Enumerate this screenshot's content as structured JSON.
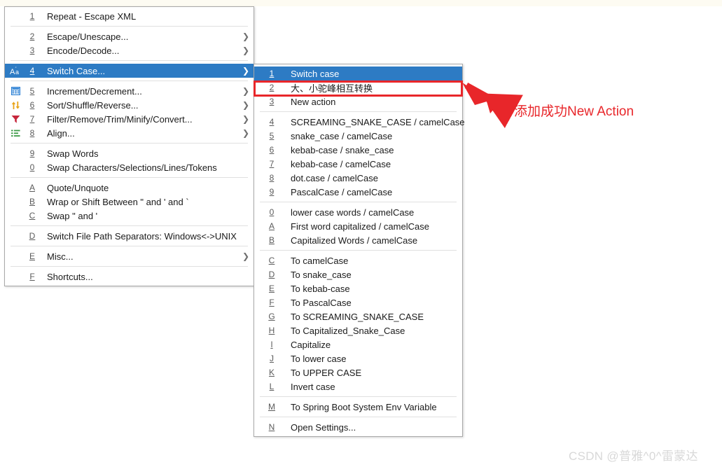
{
  "app": {
    "context": "String Manipulation plugin context menu",
    "accent_blue": "#2d7bc4",
    "annotation_red": "#e8262a",
    "watermark_color": "#d8d8d8"
  },
  "annotation": {
    "text": "添加成功New Action",
    "arrow": "red-arrow-pointing-left",
    "highlight_target": "大、小驼峰相互转换"
  },
  "watermark": {
    "text": "CSDN @普雅^0^雷蒙达"
  },
  "left_menu": {
    "name": "String Manipulation main menu",
    "groups": [
      {
        "items": [
          {
            "mnemonic": "1",
            "label": "Repeat - Escape XML",
            "icon": "",
            "submenu": false,
            "selected": false
          }
        ]
      },
      {
        "items": [
          {
            "mnemonic": "2",
            "label": "Escape/Unescape...",
            "icon": "",
            "submenu": true,
            "selected": false
          },
          {
            "mnemonic": "3",
            "label": "Encode/Decode...",
            "icon": "",
            "submenu": true,
            "selected": false
          }
        ]
      },
      {
        "items": [
          {
            "mnemonic": "4",
            "label": "Switch Case...",
            "icon": "switch-case-aa-icon",
            "submenu": true,
            "selected": true
          }
        ]
      },
      {
        "items": [
          {
            "mnemonic": "5",
            "label": "Increment/Decrement...",
            "icon": "table-grid-icon",
            "submenu": true,
            "selected": false
          },
          {
            "mnemonic": "6",
            "label": "Sort/Shuffle/Reverse...",
            "icon": "sort-arrows-icon",
            "submenu": true,
            "selected": false
          },
          {
            "mnemonic": "7",
            "label": "Filter/Remove/Trim/Minify/Convert...",
            "icon": "filter-funnel-icon",
            "submenu": true,
            "selected": false
          },
          {
            "mnemonic": "8",
            "label": "Align...",
            "icon": "align-lines-icon",
            "submenu": true,
            "selected": false
          }
        ]
      },
      {
        "items": [
          {
            "mnemonic": "9",
            "label": "Swap Words",
            "icon": "",
            "submenu": false,
            "selected": false
          },
          {
            "mnemonic": "0",
            "label": "Swap Characters/Selections/Lines/Tokens",
            "icon": "",
            "submenu": false,
            "selected": false
          }
        ]
      },
      {
        "items": [
          {
            "mnemonic": "A",
            "label": "Quote/Unquote",
            "icon": "",
            "submenu": false,
            "selected": false
          },
          {
            "mnemonic": "B",
            "label": "Wrap or Shift Between \" and ' and `",
            "icon": "",
            "submenu": false,
            "selected": false
          },
          {
            "mnemonic": "C",
            "label": "Swap \" and '",
            "icon": "",
            "submenu": false,
            "selected": false
          }
        ]
      },
      {
        "items": [
          {
            "mnemonic": "D",
            "label": "Switch File Path Separators: Windows<->UNIX",
            "icon": "",
            "submenu": false,
            "selected": false
          }
        ]
      },
      {
        "items": [
          {
            "mnemonic": "E",
            "label": "Misc...",
            "icon": "",
            "submenu": true,
            "selected": false
          }
        ]
      },
      {
        "items": [
          {
            "mnemonic": "F",
            "label": "Shortcuts...",
            "icon": "",
            "submenu": false,
            "selected": false
          }
        ]
      }
    ]
  },
  "sub_menu": {
    "name": "Switch Case submenu",
    "groups": [
      {
        "items": [
          {
            "mnemonic": "1",
            "label": "Switch case",
            "selected": true,
            "boxed": false
          },
          {
            "mnemonic": "2",
            "label": "大、小驼峰相互转换",
            "selected": false,
            "boxed": true
          },
          {
            "mnemonic": "3",
            "label": "New action",
            "selected": false,
            "boxed": false
          }
        ]
      },
      {
        "items": [
          {
            "mnemonic": "4",
            "label": "SCREAMING_SNAKE_CASE / camelCase",
            "selected": false,
            "boxed": false
          },
          {
            "mnemonic": "5",
            "label": "snake_case / camelCase",
            "selected": false,
            "boxed": false
          },
          {
            "mnemonic": "6",
            "label": "kebab-case / snake_case",
            "selected": false,
            "boxed": false
          },
          {
            "mnemonic": "7",
            "label": "kebab-case / camelCase",
            "selected": false,
            "boxed": false
          },
          {
            "mnemonic": "8",
            "label": "dot.case / camelCase",
            "selected": false,
            "boxed": false
          },
          {
            "mnemonic": "9",
            "label": "PascalCase / camelCase",
            "selected": false,
            "boxed": false
          }
        ]
      },
      {
        "items": [
          {
            "mnemonic": "0",
            "label": "lower case words / camelCase",
            "selected": false,
            "boxed": false
          },
          {
            "mnemonic": "A",
            "label": "First word capitalized / camelCase",
            "selected": false,
            "boxed": false
          },
          {
            "mnemonic": "B",
            "label": "Capitalized Words / camelCase",
            "selected": false,
            "boxed": false
          }
        ]
      },
      {
        "items": [
          {
            "mnemonic": "C",
            "label": "To camelCase",
            "selected": false,
            "boxed": false
          },
          {
            "mnemonic": "D",
            "label": "To snake_case",
            "selected": false,
            "boxed": false
          },
          {
            "mnemonic": "E",
            "label": "To kebab-case",
            "selected": false,
            "boxed": false
          },
          {
            "mnemonic": "F",
            "label": "To PascalCase",
            "selected": false,
            "boxed": false
          },
          {
            "mnemonic": "G",
            "label": "To SCREAMING_SNAKE_CASE",
            "selected": false,
            "boxed": false
          },
          {
            "mnemonic": "H",
            "label": "To Capitalized_Snake_Case",
            "selected": false,
            "boxed": false
          },
          {
            "mnemonic": "I",
            "label": "Capitalize",
            "selected": false,
            "boxed": false
          },
          {
            "mnemonic": "J",
            "label": "To lower case",
            "selected": false,
            "boxed": false
          },
          {
            "mnemonic": "K",
            "label": "To UPPER CASE",
            "selected": false,
            "boxed": false
          },
          {
            "mnemonic": "L",
            "label": "Invert case",
            "selected": false,
            "boxed": false
          }
        ]
      },
      {
        "items": [
          {
            "mnemonic": "M",
            "label": "To Spring Boot System Env Variable",
            "selected": false,
            "boxed": false
          }
        ]
      },
      {
        "items": [
          {
            "mnemonic": "N",
            "label": "Open Settings...",
            "selected": false,
            "boxed": false
          }
        ]
      }
    ]
  }
}
